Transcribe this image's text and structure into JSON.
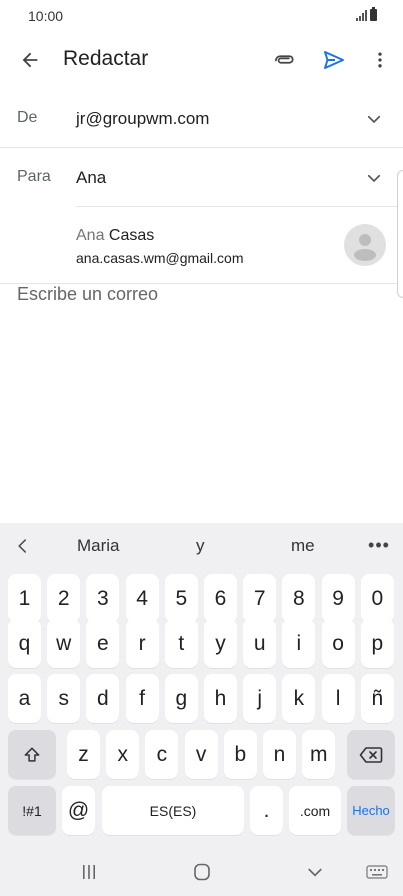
{
  "status_bar": {
    "time": "10:00"
  },
  "app_bar": {
    "title": "Redactar"
  },
  "from": {
    "label": "De",
    "value": "jr@groupwm.com"
  },
  "to": {
    "label": "Para",
    "value": "Ana"
  },
  "suggestion": {
    "name_match": "Ana",
    "name_rest": " Casas",
    "email": "ana.casas.wm@gmail.com"
  },
  "body": {
    "placeholder": "Escribe un correo"
  },
  "keyboard": {
    "suggestions": [
      "Maria",
      "y",
      "me"
    ],
    "more": "•••",
    "number_row": [
      "1",
      "2",
      "3",
      "4",
      "5",
      "6",
      "7",
      "8",
      "9",
      "0"
    ],
    "row1": [
      "q",
      "w",
      "e",
      "r",
      "t",
      "y",
      "u",
      "i",
      "o",
      "p"
    ],
    "row2": [
      "a",
      "s",
      "d",
      "f",
      "g",
      "h",
      "j",
      "k",
      "l",
      "ñ"
    ],
    "row3": [
      "z",
      "x",
      "c",
      "v",
      "b",
      "n",
      "m"
    ],
    "symbols": "!#1",
    "at": "@",
    "space": "ES(ES)",
    "period": ".",
    "dotcom": ".com",
    "done": "Hecho"
  },
  "colors": {
    "accent": "#1a73e8",
    "keyboard_bg": "#f0f0f2",
    "func_key": "#dcdce0"
  }
}
